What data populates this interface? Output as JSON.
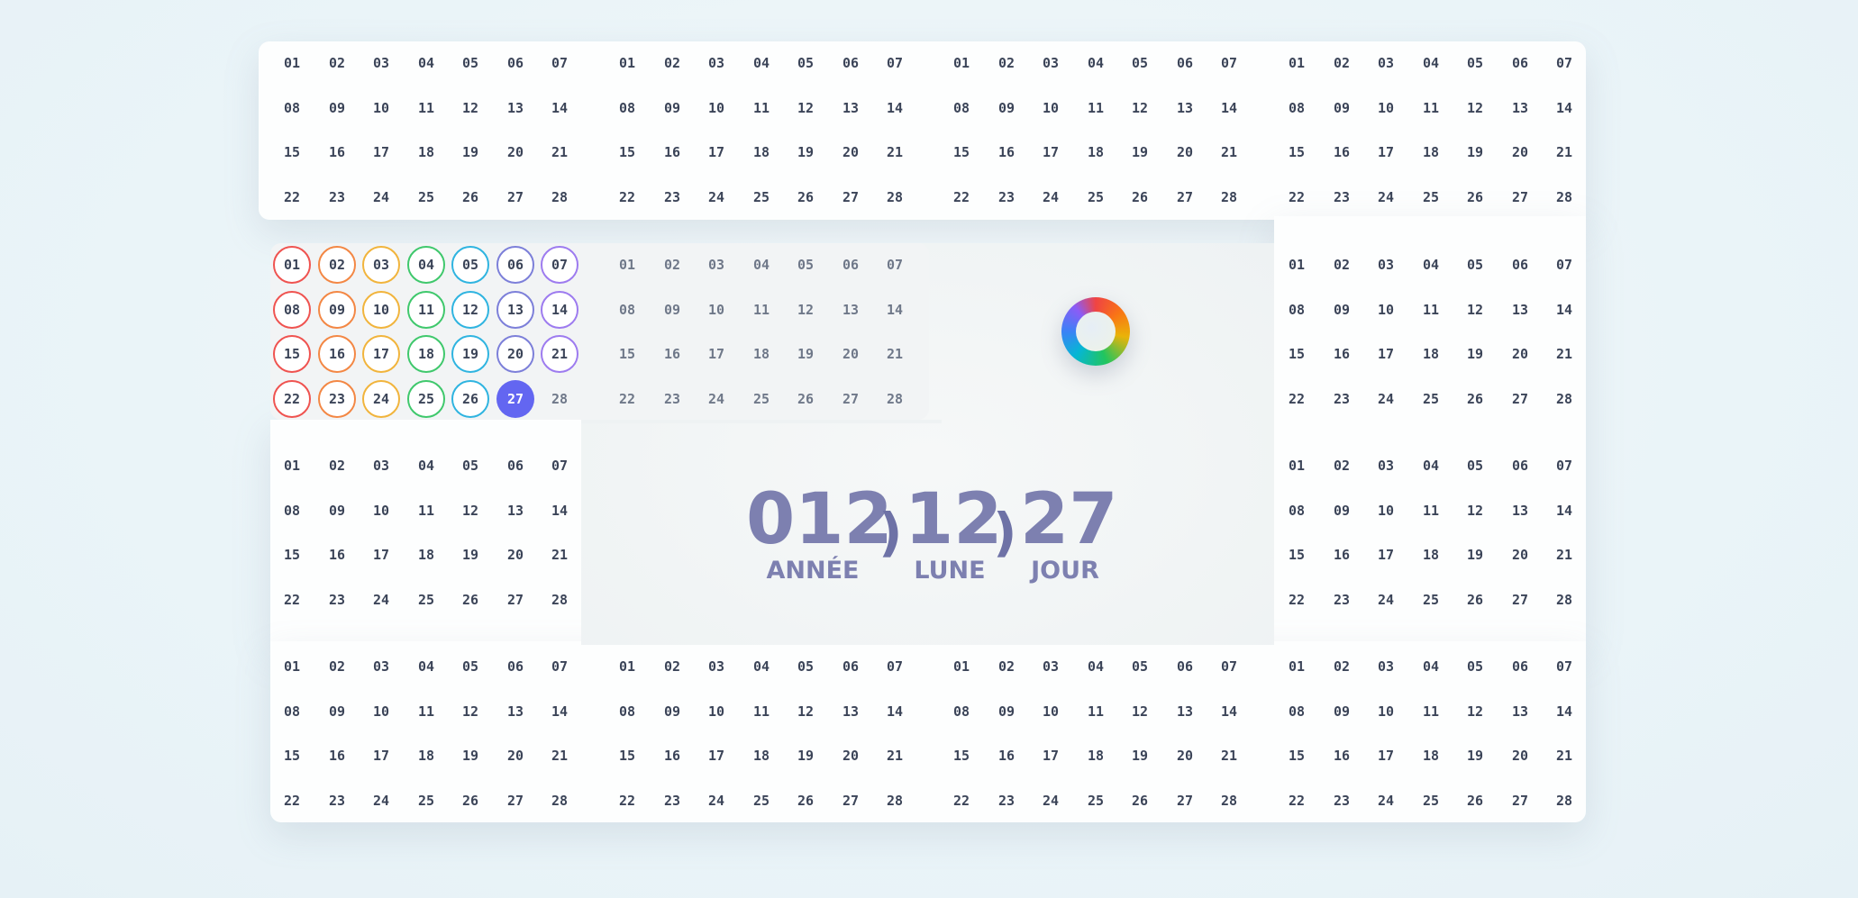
{
  "days": [
    "01",
    "02",
    "03",
    "04",
    "05",
    "06",
    "07",
    "08",
    "09",
    "10",
    "11",
    "12",
    "13",
    "14",
    "15",
    "16",
    "17",
    "18",
    "19",
    "20",
    "21",
    "22",
    "23",
    "24",
    "25",
    "26",
    "27",
    "28"
  ],
  "current_day": 27,
  "day_colors": [
    "#ef5350",
    "#f38744",
    "#f1b43c",
    "#3fc86c",
    "#2fb4e0",
    "#7c7fd9",
    "#9d7bef"
  ],
  "current_day_color": "#6366f1",
  "date_display": {
    "year_value": "012",
    "year_label": "ANNÉE",
    "month_value": "12",
    "month_label": "LUNE",
    "day_value": "27",
    "day_label": "JOUR",
    "separator": ")"
  }
}
